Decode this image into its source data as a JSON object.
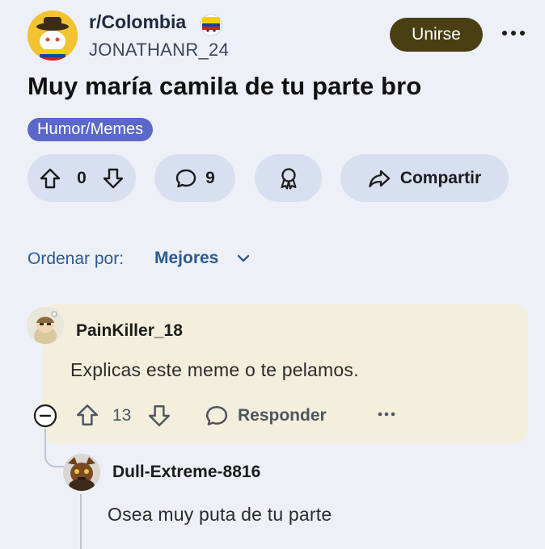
{
  "post": {
    "subreddit": "r/Colombia",
    "author": "JONATHANR_24",
    "join_label": "Unirse",
    "title": "Muy maría camila de tu parte bro",
    "flair": "Humor/Memes",
    "score": "0",
    "comments": "9",
    "share_label": "Compartir"
  },
  "sort": {
    "label": "Ordenar por:",
    "value": "Mejores"
  },
  "comments": [
    {
      "user": "PainKiller_18",
      "body": "Explicas este meme o te pelamos.",
      "score": "13",
      "reply_label": "Responder"
    },
    {
      "user": "Dull-Extreme-8816",
      "body": "Osea muy puta de tu parte"
    }
  ],
  "colors": {
    "background": "#eef0f8",
    "join_button": "#4a3f12",
    "flair": "#5b67c9",
    "pill": "#d8dff0",
    "sort_text": "#2a5b8f",
    "comment_card": "#f3efdc"
  },
  "icons": [
    "more-icon",
    "upvote-icon",
    "downvote-icon",
    "comment-icon",
    "award-icon",
    "share-icon",
    "chevron-down-icon",
    "collapse-icon",
    "reply-icon"
  ]
}
